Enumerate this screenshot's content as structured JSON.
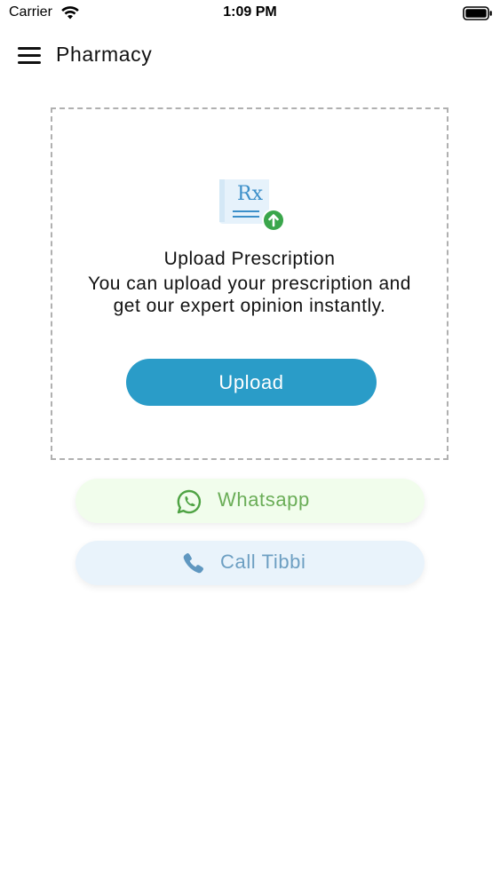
{
  "status_bar": {
    "carrier": "Carrier",
    "time": "1:09 PM",
    "icons": [
      "wifi-icon",
      "battery-icon"
    ]
  },
  "header": {
    "title": "Pharmacy",
    "menu_icon": "hamburger-menu-icon"
  },
  "upload_card": {
    "icon": "prescription-upload-icon",
    "icon_text": "Rx",
    "title": "Upload Prescription",
    "description": "You can upload your prescription and get our expert opinion instantly.",
    "button_label": "Upload"
  },
  "contact": {
    "whatsapp_label": "Whatsapp",
    "whatsapp_icon": "whatsapp-icon",
    "call_label": "Call Tibbi",
    "call_icon": "phone-icon"
  },
  "colors": {
    "primary": "#2a9cc8",
    "whatsapp_bg": "#f1fdec",
    "whatsapp_text": "#6aad57",
    "call_bg": "#e9f3fb",
    "call_text": "#6d9fc2",
    "upload_badge": "#3aa64b"
  }
}
